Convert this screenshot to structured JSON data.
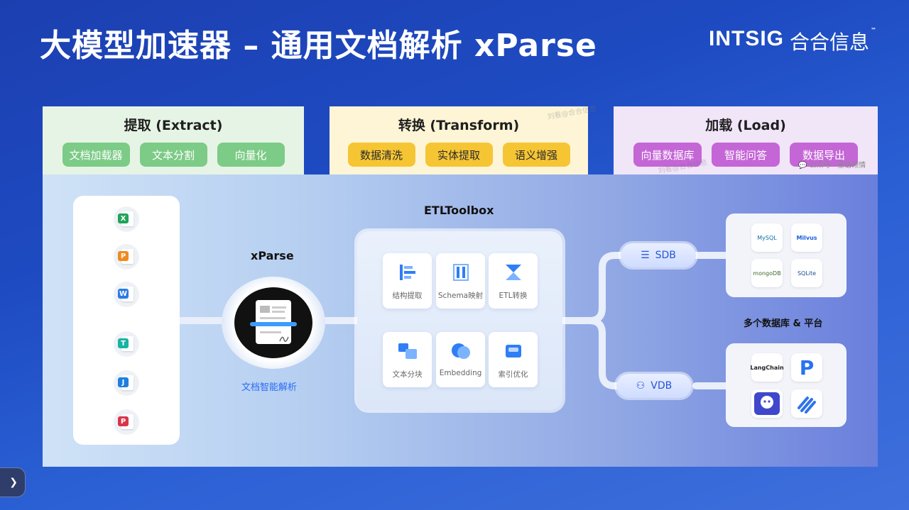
{
  "header": {
    "title": "大模型加速器 – 通用文档解析 xParse",
    "brand_en": "INTSIG",
    "brand_cn": "合合信息",
    "brand_tm": "™"
  },
  "stages": {
    "extract": {
      "title": "提取 (Extract)",
      "chips": [
        "文档加载器",
        "文本分割",
        "向量化"
      ]
    },
    "transform": {
      "title": "转换 (Transform)",
      "chips": [
        "数据清洗",
        "实体提取",
        "语义增强"
      ]
    },
    "load": {
      "title": "加载 (Load)",
      "chips": [
        "向量数据库",
        "智能问答",
        "数据导出"
      ]
    }
  },
  "watermarks": {
    "w1": "刘看@合合信息",
    "w2": "刘看@合合信息",
    "wechat": "公众号 · 星语倾情"
  },
  "file_types": [
    "X",
    "P",
    "W",
    "T",
    "J",
    "P"
  ],
  "xparse": {
    "label": "xParse",
    "subtitle": "文档智能解析"
  },
  "etl": {
    "label": "ETLToolbox",
    "cards": [
      "结构提取",
      "Schema映射",
      "ETL转换",
      "文本分块",
      "Embedding",
      "索引优化"
    ]
  },
  "outputs": {
    "sdb": "SDB",
    "vdb": "VDB",
    "caption": "多个数据库 & 平台",
    "sdb_logos": [
      "MySQL",
      "Milvus",
      "mongoDB",
      "SQLite"
    ],
    "vdb_logos": [
      "LangChain",
      "P",
      "",
      ""
    ]
  },
  "nav": {
    "arrow": "❯"
  },
  "colors": {
    "extract": "#7ccb86",
    "transform": "#f6c534",
    "load": "#c466d6",
    "accent": "#2a6cf5"
  }
}
